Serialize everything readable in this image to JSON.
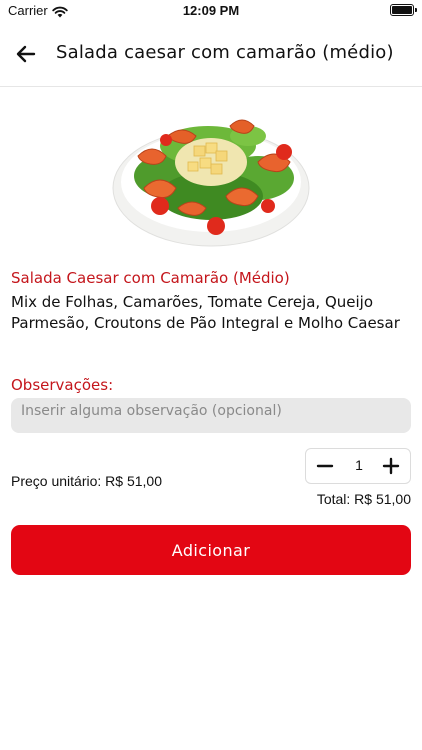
{
  "status_bar": {
    "carrier": "Carrier",
    "time": "12:09 PM"
  },
  "header": {
    "title": "Salada caesar com camarão (médio)",
    "back_icon": "arrow-left-icon"
  },
  "product": {
    "name": "Salada Caesar com Camarão (Médio)",
    "description": "Mix de Folhas, Camarões, Tomate Cereja, Queijo Parmesão, Croutons de Pão Integral e Molho Caesar"
  },
  "observations": {
    "label": "Observações:",
    "value": "",
    "placeholder": "Inserir alguma observação (opcional)"
  },
  "pricing": {
    "unit_price": "Preço unitário: R$ 51,00",
    "quantity": "1",
    "total": "Total: R$ 51,00"
  },
  "actions": {
    "add_label": "Adicionar"
  },
  "colors": {
    "accent": "#c4161c",
    "button": "#e30613",
    "input_bg": "#e8e8e8"
  }
}
